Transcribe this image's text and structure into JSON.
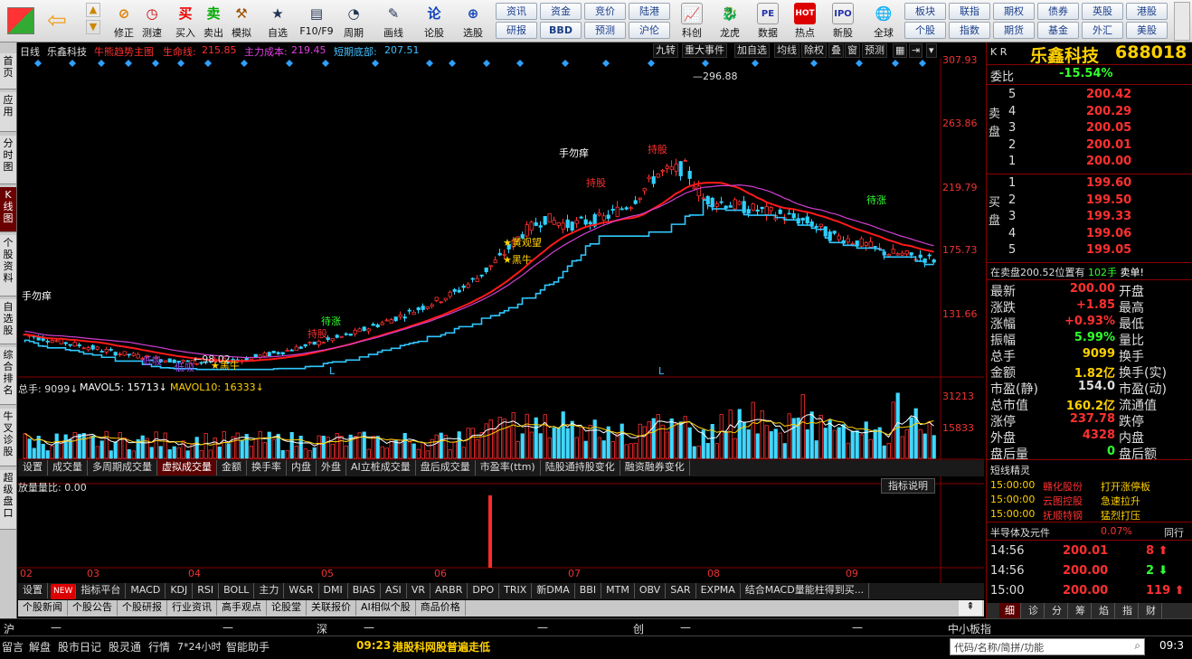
{
  "toolbar": {
    "left": [
      "修正",
      "测速"
    ],
    "trade": [
      "买入",
      "卖出",
      "模拟"
    ],
    "mid": [
      "自选",
      "F10/F9",
      "周期",
      "画线",
      "论股",
      "选股"
    ],
    "menus": [
      [
        "资讯",
        "资金",
        "竞价",
        "陆港"
      ],
      [
        "研报",
        "BBD",
        "预测",
        "沪伦"
      ]
    ],
    "icons2": [
      "科创",
      "龙虎",
      "数据",
      "热点",
      "新股"
    ],
    "globe": "全球",
    "menus2": [
      [
        "板块",
        "联指",
        "期权",
        "债券",
        "英股",
        "港股"
      ],
      [
        "个股",
        "指数",
        "期货",
        "基金",
        "外汇",
        "美股"
      ]
    ]
  },
  "sidebar": [
    "首页",
    "应用",
    "分时图",
    "K线图",
    "个股资料",
    "自选股",
    "综合排名",
    "牛叉诊股",
    "超级盘口"
  ],
  "chart_header": {
    "period": "日线",
    "name": "乐鑫科技",
    "ind_name": "牛熊趋势主图",
    "life_label": "生命线:",
    "life_val": "215.85",
    "main_label": "主力成本:",
    "main_val": "219.45",
    "bottom_label": "短期底部:",
    "bottom_val": "207.51",
    "right_tools": [
      "九转",
      "重大事件",
      "加自选",
      "均线",
      "除权",
      "叠",
      "窗",
      "预测"
    ]
  },
  "axis": {
    "p1": "307.93",
    "p2": "263.86",
    "p3": "219.79",
    "p4": "175.73",
    "p5": "131.66",
    "v1": "31213",
    "v2": "15833"
  },
  "annotations": {
    "high": "296.88",
    "low": "98.02",
    "l1": "L",
    "l2": "L"
  },
  "signals": [
    {
      "t": "手勿痒",
      "c": "#fff"
    },
    {
      "t": "低吸",
      "c": "#a050ff"
    },
    {
      "t": "低吸",
      "c": "#a050ff"
    },
    {
      "t": "黑牛",
      "c": "#ffd000"
    },
    {
      "t": "待涨",
      "c": "#30ff30"
    },
    {
      "t": "持股",
      "c": "#ff3030"
    },
    {
      "t": "黄观望",
      "c": "#ffd000"
    },
    {
      "t": "黑牛",
      "c": "#ffd000"
    },
    {
      "t": "手勿痒",
      "c": "#fff"
    },
    {
      "t": "持股",
      "c": "#ff3030"
    },
    {
      "t": "持股",
      "c": "#ff3030"
    },
    {
      "t": "待涨",
      "c": "#30ff30"
    }
  ],
  "volume": {
    "label": "总手: 9099",
    "ma5": "MAVOL5: 15713",
    "ma10": "MAVOL10: 16333"
  },
  "tabs1": [
    "设置",
    "成交量",
    "多周期成交量",
    "虚拟成交量",
    "金额",
    "换手率",
    "内盘",
    "外盘",
    "AI立桩成交量",
    "盘后成交量",
    "市盈率(ttm)",
    "陆股通持股变化",
    "融资融券变化"
  ],
  "ind_panel": {
    "label": "放量量比: 0.00",
    "desc_btn": "指标说明"
  },
  "months": [
    "02",
    "03",
    "04",
    "05",
    "06",
    "07",
    "08",
    "09"
  ],
  "tabs2": [
    "设置",
    "NEW",
    "指标平台",
    "MACD",
    "KDJ",
    "RSI",
    "BOLL",
    "主力",
    "W&R",
    "DMI",
    "BIAS",
    "ASI",
    "VR",
    "ARBR",
    "DPO",
    "TRIX",
    "新DMA",
    "BBI",
    "MTM",
    "OBV",
    "SAR",
    "EXPMA",
    "结合MACD量能柱得到买..."
  ],
  "tabs3": [
    "个股新闻",
    "个股公告",
    "个股研报",
    "行业资讯",
    "高手观点",
    "论股堂",
    "关联报价",
    "AI相似个股",
    "商品价格"
  ],
  "quote": {
    "kr": "K R",
    "name": "乐鑫科技",
    "code": "688018",
    "wb_label": "委比",
    "wb": "-15.54%",
    "sell_label": "卖盘",
    "buy_label": "买盘",
    "sell": [
      [
        "5",
        "200.42"
      ],
      [
        "4",
        "200.29"
      ],
      [
        "3",
        "200.05"
      ],
      [
        "2",
        "200.01"
      ],
      [
        "1",
        "200.00"
      ]
    ],
    "buy": [
      [
        "1",
        "199.60"
      ],
      [
        "2",
        "199.50"
      ],
      [
        "3",
        "199.33"
      ],
      [
        "4",
        "199.06"
      ],
      [
        "5",
        "199.05"
      ]
    ],
    "alert": "在卖盘200.52位置有",
    "alert_v": "102手",
    "alert_tail": "卖单!",
    "left": [
      [
        "最新",
        "200.00"
      ],
      [
        "涨跌",
        "+1.85"
      ],
      [
        "涨幅",
        "+0.93%"
      ],
      [
        "振幅",
        "5.99%"
      ],
      [
        "总手",
        "9099"
      ],
      [
        "金额",
        "1.82亿"
      ],
      [
        "市盈(静)",
        "154.0"
      ],
      [
        "总市值",
        "160.2亿"
      ],
      [
        "涨停",
        "237.78"
      ],
      [
        "外盘",
        "4328"
      ],
      [
        "盘后量",
        "0"
      ]
    ],
    "right": [
      "开盘",
      "最高",
      "最低",
      "量比",
      "换手",
      "换手(实)",
      "市盈(动)",
      "流通值",
      "跌停",
      "内盘",
      "盘后额"
    ],
    "short_title": "短线精灵",
    "short": [
      [
        "15:00:00",
        "赣化股份",
        "打开涨停板"
      ],
      [
        "15:00:00",
        "云图控股",
        "急速拉升"
      ],
      [
        "15:00:00",
        "抚顺特钢",
        "猛烈打压"
      ]
    ],
    "sector": "半导体及元件",
    "sector_pct": "0.07%",
    "sector_tail": "同行",
    "ticks": [
      [
        "14:56",
        "200.01",
        "8"
      ],
      [
        "14:56",
        "200.00",
        "2"
      ],
      [
        "15:00",
        "200.00",
        "119"
      ]
    ],
    "bottom_tabs": [
      "细",
      "诊",
      "分",
      "筹",
      "焰",
      "指",
      "财"
    ]
  },
  "status": {
    "markets": [
      [
        "沪",
        "—",
        "—"
      ],
      [
        "深",
        "—",
        "—"
      ],
      [
        "创",
        "—",
        "—"
      ]
    ],
    "smb": "中小板指",
    "left": [
      "留言",
      "解盘",
      "股市日记",
      "股灵通",
      "行情",
      "7*24小时",
      "智能助手"
    ],
    "ticker_time": "09:23",
    "ticker": "港股科网股普遍走低",
    "search_ph": "代码/名称/简拼/功能",
    "clock": "09:3"
  }
}
